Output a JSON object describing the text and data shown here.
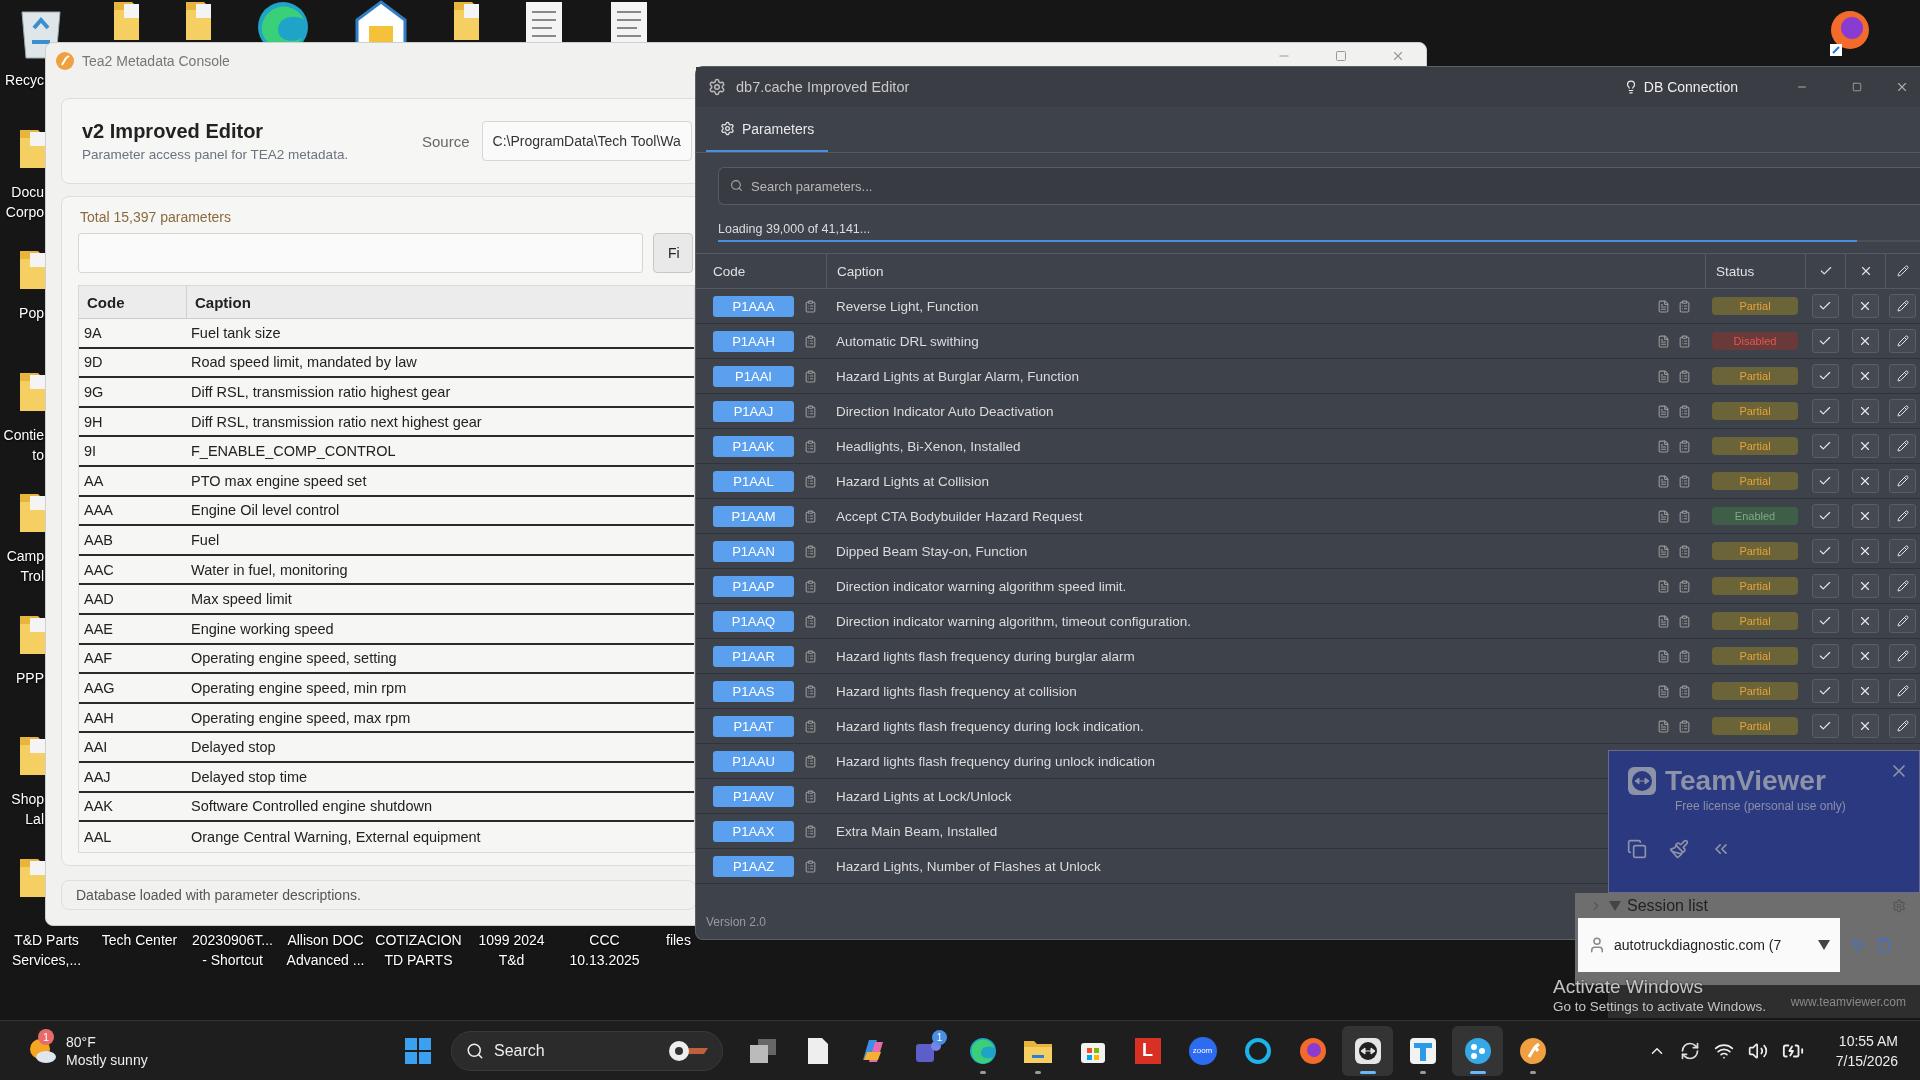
{
  "desktop_icons": {
    "left_column": [
      {
        "kind": "recycle",
        "label": [
          "Recyc"
        ]
      },
      {
        "kind": "folder",
        "label": [
          "Docu",
          "Corpo"
        ]
      },
      {
        "kind": "folder",
        "label": [
          "Pop"
        ]
      },
      {
        "kind": "folder",
        "label": [
          "Contie",
          "to"
        ]
      },
      {
        "kind": "folder",
        "label": [
          "Camp",
          "Trol"
        ]
      },
      {
        "kind": "folder",
        "label": [
          "PPP"
        ]
      },
      {
        "kind": "folder",
        "label": [
          "Shop",
          "Lal"
        ]
      },
      {
        "kind": "folder"
      }
    ],
    "top_row": [
      {
        "kind": "folder"
      },
      {
        "kind": "folder"
      },
      {
        "kind": "edge"
      },
      {
        "kind": "home"
      },
      {
        "kind": "folder"
      },
      {
        "kind": "document"
      },
      {
        "kind": "document"
      }
    ],
    "top_right": [
      {
        "kind": "firefox"
      }
    ],
    "bottom_labels": [
      [
        "T&D Parts",
        "Services,..."
      ],
      [
        "Tech Center"
      ],
      [
        "20230906T...",
        "- Shortcut"
      ],
      [
        "Allison DOC",
        "Advanced ..."
      ],
      [
        "COTIZACION",
        "TD PARTS"
      ],
      [
        "1099 2024",
        "T&d"
      ],
      [
        "CCC",
        "10.13.2025"
      ],
      [
        "files"
      ]
    ]
  },
  "metadata_window": {
    "title": "Tea2 Metadata Console",
    "heading": "v2 Improved Editor",
    "subtitle": "Parameter access panel for TEA2 metadata.",
    "source": {
      "label": "Source",
      "value": "C:\\ProgramData\\Tech Tool\\Wa"
    },
    "total": "Total 15,397 parameters",
    "find_button": "Fi",
    "table": {
      "columns": [
        "Code",
        "Caption"
      ],
      "rows": [
        [
          "9A",
          "Fuel tank size"
        ],
        [
          "9D",
          "Road speed limit, mandated by law"
        ],
        [
          "9G",
          "Diff RSL, transmission ratio highest gear"
        ],
        [
          "9H",
          "Diff RSL, transmission ratio next highest gear"
        ],
        [
          "9I",
          "F_ENABLE_COMP_CONTROL"
        ],
        [
          "AA",
          "PTO max engine speed set"
        ],
        [
          "AAA",
          "Engine Oil level control"
        ],
        [
          "AAB",
          "Fuel"
        ],
        [
          "AAC",
          "Water in fuel, monitoring"
        ],
        [
          "AAD",
          "Max speed limit"
        ],
        [
          "AAE",
          "Engine working speed"
        ],
        [
          "AAF",
          "Operating engine speed, setting"
        ],
        [
          "AAG",
          "Operating engine speed, min rpm"
        ],
        [
          "AAH",
          "Operating engine speed, max rpm"
        ],
        [
          "AAI",
          "Delayed stop"
        ],
        [
          "AAJ",
          "Delayed stop time"
        ],
        [
          "AAK",
          "Software Controlled engine shutdown"
        ],
        [
          "AAL",
          "Orange Central Warning, External equipment"
        ]
      ]
    },
    "status": "Database loaded with parameter descriptions."
  },
  "editor_window": {
    "title": "db7.cache Improved Editor",
    "connection": "DB Connection",
    "tabs": [
      {
        "label": "Parameters",
        "selected": true
      }
    ],
    "search": {
      "placeholder": "Search parameters..."
    },
    "loading": {
      "text": "Loading 39,000 of 41,141...",
      "level": 0.948
    },
    "table": {
      "columns": [
        "Code",
        "Caption",
        "Status"
      ],
      "rows": [
        {
          "code": "P1AAA",
          "caption": "Reverse Light, Function",
          "status": {
            "label": "Partial",
            "kind": "partial"
          }
        },
        {
          "code": "P1AAH",
          "caption": "Automatic DRL swithing",
          "status": {
            "label": "Disabled",
            "kind": "disabled"
          }
        },
        {
          "code": "P1AAI",
          "caption": "Hazard Lights at Burglar Alarm, Function",
          "status": {
            "label": "Partial",
            "kind": "partial"
          }
        },
        {
          "code": "P1AAJ",
          "caption": "Direction Indicator Auto Deactivation",
          "status": {
            "label": "Partial",
            "kind": "partial"
          }
        },
        {
          "code": "P1AAK",
          "caption": "Headlights, Bi-Xenon, Installed",
          "status": {
            "label": "Partial",
            "kind": "partial"
          }
        },
        {
          "code": "P1AAL",
          "caption": "Hazard Lights at Collision",
          "status": {
            "label": "Partial",
            "kind": "partial"
          }
        },
        {
          "code": "P1AAM",
          "caption": "Accept CTA Bodybuilder Hazard Request",
          "status": {
            "label": "Enabled",
            "kind": "enabled"
          }
        },
        {
          "code": "P1AAN",
          "caption": "Dipped Beam Stay-on, Function",
          "status": {
            "label": "Partial",
            "kind": "partial"
          }
        },
        {
          "code": "P1AAP",
          "caption": "Direction indicator warning algorithm speed limit.",
          "status": {
            "label": "Partial",
            "kind": "partial"
          }
        },
        {
          "code": "P1AAQ",
          "caption": "Direction indicator warning algorithm, timeout configuration.",
          "status": {
            "label": "Partial",
            "kind": "partial"
          }
        },
        {
          "code": "P1AAR",
          "caption": "Hazard lights flash frequency during burglar alarm",
          "status": {
            "label": "Partial",
            "kind": "partial"
          }
        },
        {
          "code": "P1AAS",
          "caption": "Hazard lights flash frequency at collision",
          "status": {
            "label": "Partial",
            "kind": "partial"
          }
        },
        {
          "code": "P1AAT",
          "caption": "Hazard lights flash frequency during lock indication.",
          "status": {
            "label": "Partial",
            "kind": "partial"
          }
        },
        {
          "code": "P1AAU",
          "caption": "Hazard lights flash frequency during unlock indication"
        },
        {
          "code": "P1AAV",
          "caption": "Hazard Lights at Lock/Unlock"
        },
        {
          "code": "P1AAX",
          "caption": "Extra Main Beam, Installed"
        },
        {
          "code": "P1AAZ",
          "caption": "Hazard Lights, Number of Flashes at Unlock"
        }
      ]
    },
    "version": "Version 2.0"
  },
  "teamviewer": {
    "brand": "TeamViewer",
    "license": "Free license (personal use only)",
    "session_list": {
      "title": "Session list",
      "entry": "autotruckdiagnostic.com (7"
    },
    "website": "www.teamviewer.com"
  },
  "activation": {
    "title": "Activate Windows",
    "message": "Go to Settings to activate Windows."
  },
  "taskbar": {
    "weather": {
      "badge": "1",
      "temperature": "80°F",
      "condition": "Mostly sunny"
    },
    "search": {
      "label": "Search"
    },
    "apps": [
      {
        "kind": "start",
        "open": false,
        "selected": false
      },
      {
        "kind": "taskview",
        "open": false,
        "selected": false
      },
      {
        "kind": "notepad",
        "open": false,
        "selected": false
      },
      {
        "kind": "copilot",
        "open": false,
        "selected": false
      },
      {
        "kind": "teams",
        "badge": "1",
        "open": false,
        "selected": false
      },
      {
        "kind": "edge",
        "open": true,
        "selected": false
      },
      {
        "kind": "explorer",
        "open": true,
        "selected": false
      },
      {
        "kind": "store",
        "open": false,
        "selected": false
      },
      {
        "kind": "letter",
        "label": "L",
        "open": false,
        "selected": false
      },
      {
        "kind": "zoom",
        "label": "zoom",
        "open": false,
        "selected": false
      },
      {
        "kind": "alexa",
        "open": false,
        "selected": false
      },
      {
        "kind": "firefox",
        "open": false,
        "selected": false
      },
      {
        "kind": "teamviewer",
        "open": true,
        "selected": true
      },
      {
        "kind": "whiteboard",
        "open": true,
        "selected": false
      },
      {
        "kind": "ripple",
        "open": true,
        "selected": true
      },
      {
        "kind": "orange",
        "open": true,
        "selected": false
      }
    ],
    "clock": {
      "time": "10:55 AM",
      "date": "7/15/2026"
    }
  }
}
